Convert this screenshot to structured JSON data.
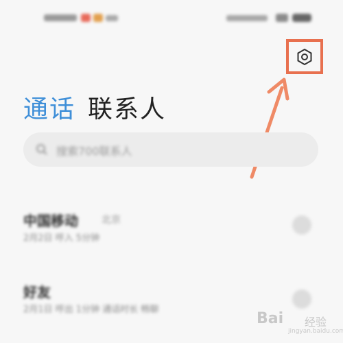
{
  "status_bar": {
    "left_text": "中国移动",
    "right_text": "5:00 4G 87"
  },
  "settings_button": {
    "icon": "gear-hexagon-icon",
    "highlight_color": "#e8704f"
  },
  "tabs": [
    {
      "label": "通话",
      "active": true,
      "color": "#3f8fd8"
    },
    {
      "label": "联系人",
      "active": false,
      "color": "#222222"
    }
  ],
  "search": {
    "placeholder": "搜索700联系人"
  },
  "call_log": [
    {
      "name": "中国移动",
      "tag": "北京",
      "detail": "2月2日 呼入 5分钟"
    },
    {
      "name": "好友",
      "tag": "",
      "detail": "2月1日 呼出 1分钟 通话时长 畅聊"
    }
  ],
  "watermark": {
    "logo": "Bai",
    "text": "经验",
    "url": "jingyan.baidu.com"
  }
}
